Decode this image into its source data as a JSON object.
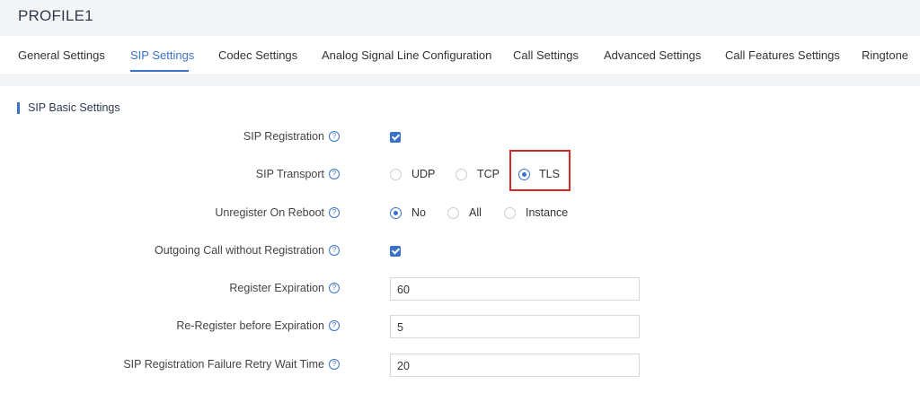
{
  "profile": {
    "title": "PROFILE1"
  },
  "tabs": [
    {
      "label": "General Settings"
    },
    {
      "label": "SIP Settings",
      "active": true
    },
    {
      "label": "Codec Settings"
    },
    {
      "label": "Analog Signal Line Configuration"
    },
    {
      "label": "Call Settings"
    },
    {
      "label": "Advanced Settings"
    },
    {
      "label": "Call Features Settings"
    },
    {
      "label": "Ringtone"
    }
  ],
  "section": {
    "title": "SIP Basic Settings"
  },
  "settings": {
    "sip_registration": {
      "label": "SIP Registration",
      "checked": true
    },
    "sip_transport": {
      "label": "SIP Transport",
      "options": [
        "UDP",
        "TCP",
        "TLS"
      ],
      "selected": "TLS"
    },
    "unregister_on_reboot": {
      "label": "Unregister On Reboot",
      "options": [
        "No",
        "All",
        "Instance"
      ],
      "selected": "No"
    },
    "outgoing_call_without_registration": {
      "label": "Outgoing Call without Registration",
      "checked": true
    },
    "register_expiration": {
      "label": "Register Expiration",
      "value": "60"
    },
    "reregister_before_expiration": {
      "label": "Re-Register before Expiration",
      "value": "5"
    },
    "failure_retry_wait_time": {
      "label": "SIP Registration Failure Retry Wait Time",
      "value": "20"
    }
  },
  "help_glyph": "?",
  "colors": {
    "accent": "#3a72c8",
    "highlight": "#d62728"
  }
}
